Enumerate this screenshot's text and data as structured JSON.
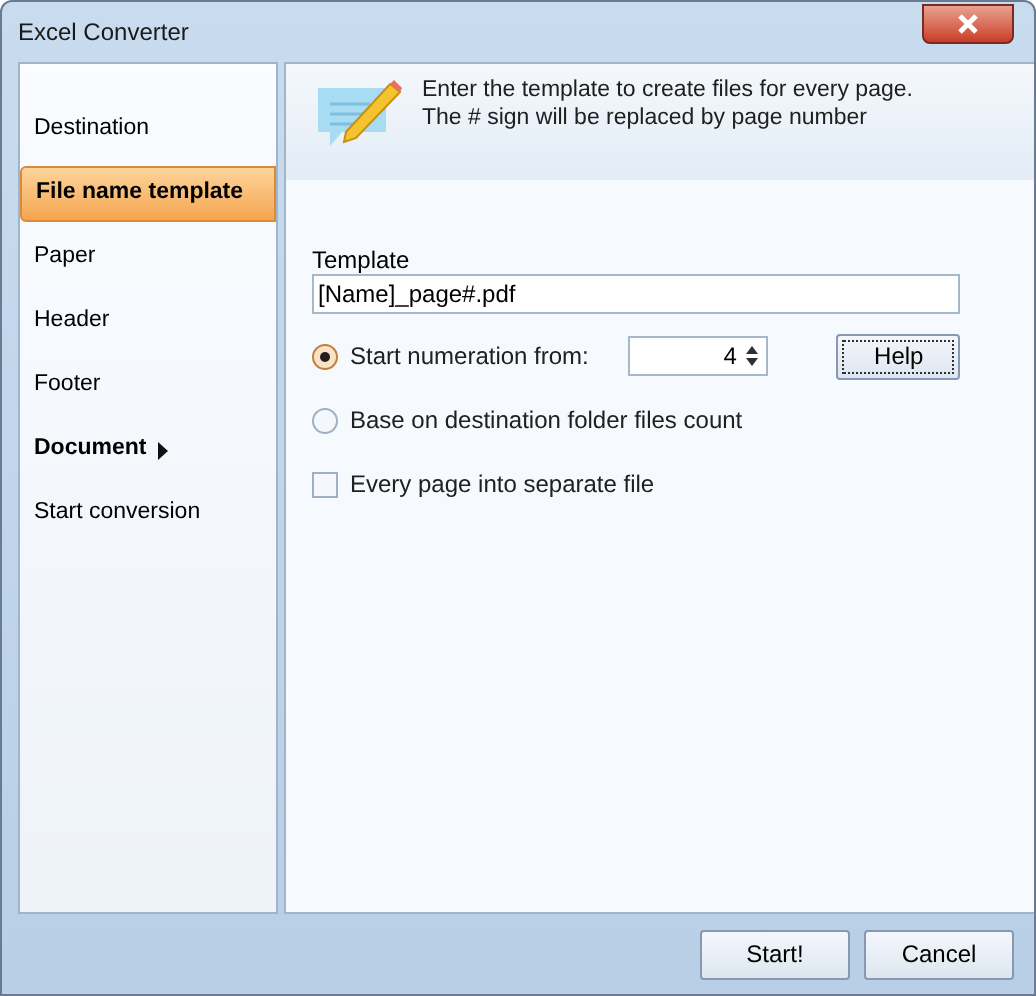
{
  "window": {
    "title": "Excel Converter"
  },
  "sidebar": {
    "items": [
      {
        "label": "Destination",
        "selected": false,
        "kind": "page"
      },
      {
        "label": "File name template",
        "selected": true,
        "kind": "page"
      },
      {
        "label": "Paper",
        "selected": false,
        "kind": "page"
      },
      {
        "label": "Header",
        "selected": false,
        "kind": "page"
      },
      {
        "label": "Footer",
        "selected": false,
        "kind": "page"
      },
      {
        "label": "Document",
        "selected": false,
        "kind": "group"
      },
      {
        "label": "Start conversion",
        "selected": false,
        "kind": "page"
      }
    ]
  },
  "header": {
    "lines": [
      "Enter the template to create files for every page.",
      "The # sign will be replaced by page number"
    ]
  },
  "template": {
    "label": "Template",
    "value": "[Name]_page#.pdf"
  },
  "options": [
    {
      "kind": "radio",
      "label": "Start numeration from:",
      "selected": true
    },
    {
      "kind": "radio",
      "label": "Base on destination folder files count",
      "selected": false
    },
    {
      "kind": "checkbox",
      "label": "Every page into separate file",
      "checked": false
    }
  ],
  "start_number": {
    "value": "4"
  },
  "help_button": "Help",
  "buttons": [
    {
      "label": "Start!"
    },
    {
      "label": "Cancel"
    }
  ]
}
